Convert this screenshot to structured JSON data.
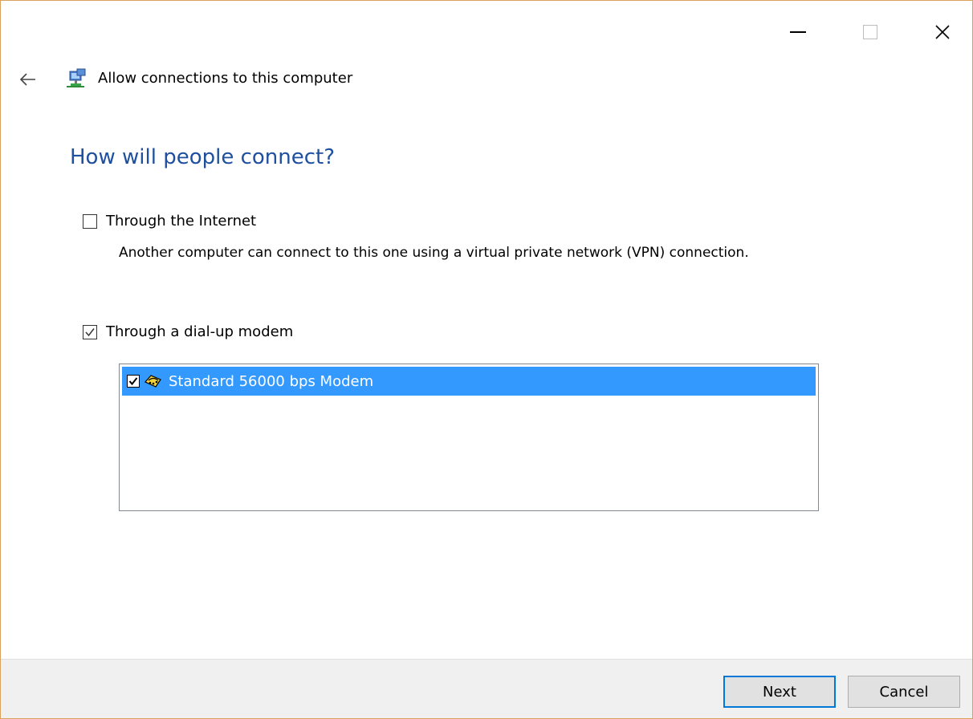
{
  "window": {
    "title": "Allow connections to this computer",
    "controls": {
      "minimize": "minimize-icon",
      "maximize": "maximize-icon",
      "close": "close-icon"
    }
  },
  "main": {
    "heading": "How will people connect?",
    "options": [
      {
        "label": "Through the Internet",
        "checked": false,
        "description": "Another computer can connect to this one using a virtual private network (VPN) connection."
      },
      {
        "label": "Through a dial-up modem",
        "checked": true
      }
    ],
    "devices": [
      {
        "label": "Standard 56000 bps Modem",
        "checked": true,
        "selected": true,
        "icon": "modem-icon"
      }
    ]
  },
  "footer": {
    "next_label": "Next",
    "cancel_label": "Cancel"
  },
  "colors": {
    "heading": "#1f4f9f",
    "selection": "#3399ff",
    "default_button_border": "#0078d7",
    "window_border": "#d9a25a"
  }
}
